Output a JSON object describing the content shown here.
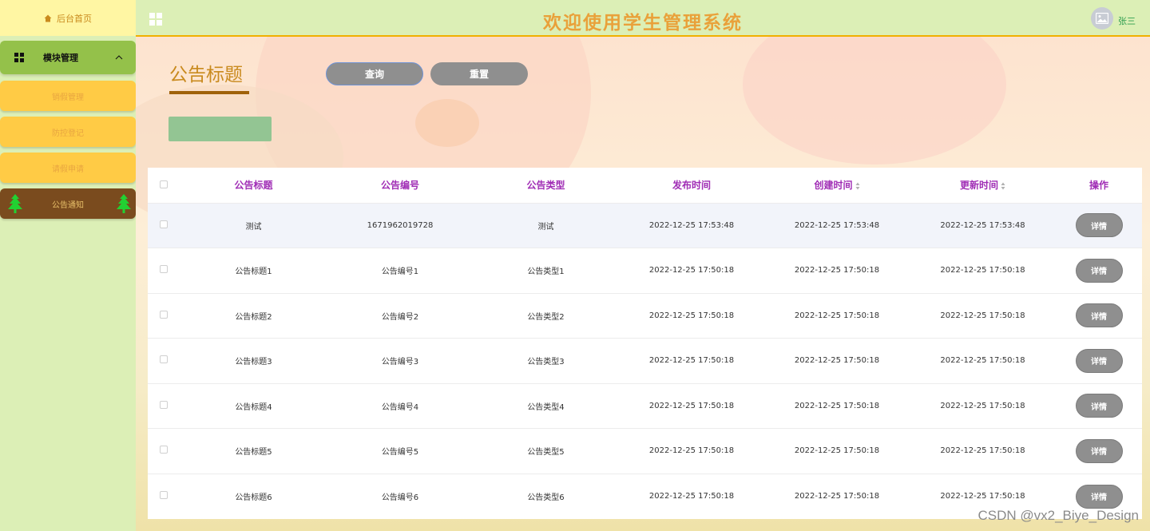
{
  "sidebar": {
    "home_label": "后台首页",
    "module_label": "模块管理",
    "items": [
      {
        "label": "销假管理"
      },
      {
        "label": "防控登记"
      },
      {
        "label": "请假申请"
      },
      {
        "label": "公告通知"
      }
    ],
    "active_index": 3
  },
  "header": {
    "title": "欢迎使用学生管理系统",
    "username": "张三"
  },
  "search": {
    "label": "公告标题",
    "search_button": "查询",
    "reset_button": "重置"
  },
  "table": {
    "columns": [
      "公告标题",
      "公告编号",
      "公告类型",
      "发布时间",
      "创建时间",
      "更新时间",
      "操作"
    ],
    "rows": [
      [
        "测试",
        "1671962019728",
        "测试",
        "2022-12-25 17:53:48",
        "2022-12-25 17:53:48",
        "2022-12-25 17:53:48"
      ],
      [
        "公告标题1",
        "公告编号1",
        "公告类型1",
        "2022-12-25 17:50:18",
        "2022-12-25 17:50:18",
        "2022-12-25 17:50:18"
      ],
      [
        "公告标题2",
        "公告编号2",
        "公告类型2",
        "2022-12-25 17:50:18",
        "2022-12-25 17:50:18",
        "2022-12-25 17:50:18"
      ],
      [
        "公告标题3",
        "公告编号3",
        "公告类型3",
        "2022-12-25 17:50:18",
        "2022-12-25 17:50:18",
        "2022-12-25 17:50:18"
      ],
      [
        "公告标题4",
        "公告编号4",
        "公告类型4",
        "2022-12-25 17:50:18",
        "2022-12-25 17:50:18",
        "2022-12-25 17:50:18"
      ],
      [
        "公告标题5",
        "公告编号5",
        "公告类型5",
        "2022-12-25 17:50:18",
        "2022-12-25 17:50:18",
        "2022-12-25 17:50:18"
      ],
      [
        "公告标题6",
        "公告编号6",
        "公告类型6",
        "2022-12-25 17:50:18",
        "2022-12-25 17:50:18",
        "2022-12-25 17:50:18"
      ]
    ],
    "action_label": "详情"
  },
  "watermark": "CSDN @vx2_Biye_Design",
  "colors": {
    "sidebar_bg": "#dcefb6",
    "accent_orange": "#e9a13a",
    "header_purple": "#a02db5",
    "button_gray": "#8f8f8f"
  }
}
